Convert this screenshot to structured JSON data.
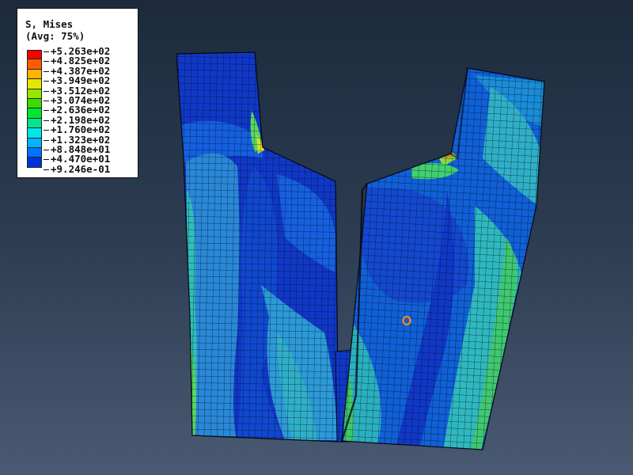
{
  "legend": {
    "title": "S, Mises",
    "subtitle": "(Avg: 75%)",
    "labels": [
      "+5.263e+02",
      "+4.825e+02",
      "+4.387e+02",
      "+3.949e+02",
      "+3.512e+02",
      "+3.074e+02",
      "+2.636e+02",
      "+2.198e+02",
      "+1.760e+02",
      "+1.323e+02",
      "+8.848e+01",
      "+4.470e+01",
      "+9.246e-01"
    ],
    "colors": [
      "#ff0000",
      "#ff5a00",
      "#ffb400",
      "#e6e600",
      "#96e600",
      "#3cdc00",
      "#00e632",
      "#00e68c",
      "#00e6e6",
      "#00b4ff",
      "#0073ff",
      "#0032dc"
    ]
  },
  "colors": {
    "background_top": "#1c2a3c",
    "background_bottom": "#4a5a72",
    "mesh_base": "#1038c8",
    "mesh_lines": "#04080f",
    "marker": "#ff8a1a"
  },
  "viewport": {
    "left_part": "left-jaw-mesh",
    "right_part": "right-jaw-mesh",
    "marker_icon": "circle-marker-icon"
  }
}
